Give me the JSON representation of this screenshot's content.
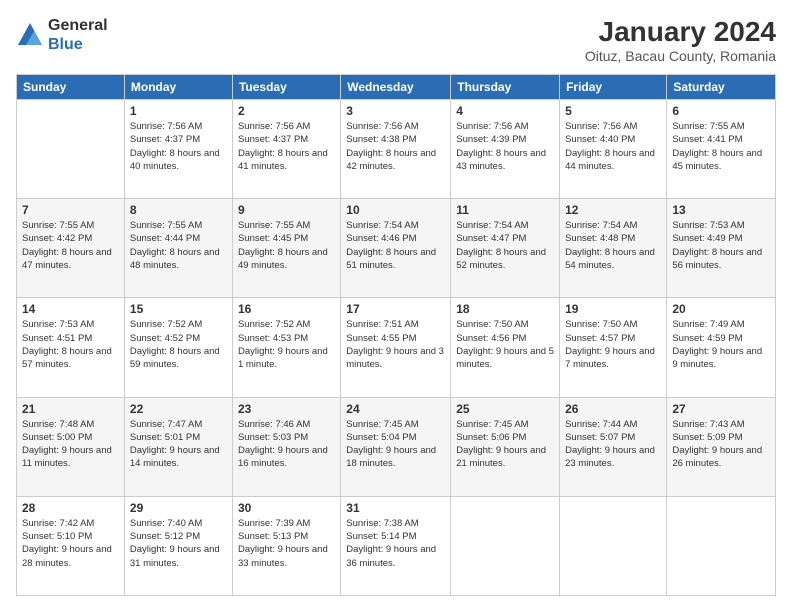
{
  "header": {
    "logo": {
      "general": "General",
      "blue": "Blue"
    },
    "title": "January 2024",
    "location": "Oituz, Bacau County, Romania"
  },
  "weekdays": [
    "Sunday",
    "Monday",
    "Tuesday",
    "Wednesday",
    "Thursday",
    "Friday",
    "Saturday"
  ],
  "weeks": [
    [
      null,
      {
        "day": 1,
        "sunrise": "7:56 AM",
        "sunset": "4:37 PM",
        "daylight": "8 hours and 40 minutes."
      },
      {
        "day": 2,
        "sunrise": "7:56 AM",
        "sunset": "4:37 PM",
        "daylight": "8 hours and 41 minutes."
      },
      {
        "day": 3,
        "sunrise": "7:56 AM",
        "sunset": "4:38 PM",
        "daylight": "8 hours and 42 minutes."
      },
      {
        "day": 4,
        "sunrise": "7:56 AM",
        "sunset": "4:39 PM",
        "daylight": "8 hours and 43 minutes."
      },
      {
        "day": 5,
        "sunrise": "7:56 AM",
        "sunset": "4:40 PM",
        "daylight": "8 hours and 44 minutes."
      },
      {
        "day": 6,
        "sunrise": "7:55 AM",
        "sunset": "4:41 PM",
        "daylight": "8 hours and 45 minutes."
      }
    ],
    [
      {
        "day": 7,
        "sunrise": "7:55 AM",
        "sunset": "4:42 PM",
        "daylight": "8 hours and 47 minutes."
      },
      {
        "day": 8,
        "sunrise": "7:55 AM",
        "sunset": "4:44 PM",
        "daylight": "8 hours and 48 minutes."
      },
      {
        "day": 9,
        "sunrise": "7:55 AM",
        "sunset": "4:45 PM",
        "daylight": "8 hours and 49 minutes."
      },
      {
        "day": 10,
        "sunrise": "7:54 AM",
        "sunset": "4:46 PM",
        "daylight": "8 hours and 51 minutes."
      },
      {
        "day": 11,
        "sunrise": "7:54 AM",
        "sunset": "4:47 PM",
        "daylight": "8 hours and 52 minutes."
      },
      {
        "day": 12,
        "sunrise": "7:54 AM",
        "sunset": "4:48 PM",
        "daylight": "8 hours and 54 minutes."
      },
      {
        "day": 13,
        "sunrise": "7:53 AM",
        "sunset": "4:49 PM",
        "daylight": "8 hours and 56 minutes."
      }
    ],
    [
      {
        "day": 14,
        "sunrise": "7:53 AM",
        "sunset": "4:51 PM",
        "daylight": "8 hours and 57 minutes."
      },
      {
        "day": 15,
        "sunrise": "7:52 AM",
        "sunset": "4:52 PM",
        "daylight": "8 hours and 59 minutes."
      },
      {
        "day": 16,
        "sunrise": "7:52 AM",
        "sunset": "4:53 PM",
        "daylight": "9 hours and 1 minute."
      },
      {
        "day": 17,
        "sunrise": "7:51 AM",
        "sunset": "4:55 PM",
        "daylight": "9 hours and 3 minutes."
      },
      {
        "day": 18,
        "sunrise": "7:50 AM",
        "sunset": "4:56 PM",
        "daylight": "9 hours and 5 minutes."
      },
      {
        "day": 19,
        "sunrise": "7:50 AM",
        "sunset": "4:57 PM",
        "daylight": "9 hours and 7 minutes."
      },
      {
        "day": 20,
        "sunrise": "7:49 AM",
        "sunset": "4:59 PM",
        "daylight": "9 hours and 9 minutes."
      }
    ],
    [
      {
        "day": 21,
        "sunrise": "7:48 AM",
        "sunset": "5:00 PM",
        "daylight": "9 hours and 11 minutes."
      },
      {
        "day": 22,
        "sunrise": "7:47 AM",
        "sunset": "5:01 PM",
        "daylight": "9 hours and 14 minutes."
      },
      {
        "day": 23,
        "sunrise": "7:46 AM",
        "sunset": "5:03 PM",
        "daylight": "9 hours and 16 minutes."
      },
      {
        "day": 24,
        "sunrise": "7:45 AM",
        "sunset": "5:04 PM",
        "daylight": "9 hours and 18 minutes."
      },
      {
        "day": 25,
        "sunrise": "7:45 AM",
        "sunset": "5:06 PM",
        "daylight": "9 hours and 21 minutes."
      },
      {
        "day": 26,
        "sunrise": "7:44 AM",
        "sunset": "5:07 PM",
        "daylight": "9 hours and 23 minutes."
      },
      {
        "day": 27,
        "sunrise": "7:43 AM",
        "sunset": "5:09 PM",
        "daylight": "9 hours and 26 minutes."
      }
    ],
    [
      {
        "day": 28,
        "sunrise": "7:42 AM",
        "sunset": "5:10 PM",
        "daylight": "9 hours and 28 minutes."
      },
      {
        "day": 29,
        "sunrise": "7:40 AM",
        "sunset": "5:12 PM",
        "daylight": "9 hours and 31 minutes."
      },
      {
        "day": 30,
        "sunrise": "7:39 AM",
        "sunset": "5:13 PM",
        "daylight": "9 hours and 33 minutes."
      },
      {
        "day": 31,
        "sunrise": "7:38 AM",
        "sunset": "5:14 PM",
        "daylight": "9 hours and 36 minutes."
      },
      null,
      null,
      null
    ]
  ]
}
